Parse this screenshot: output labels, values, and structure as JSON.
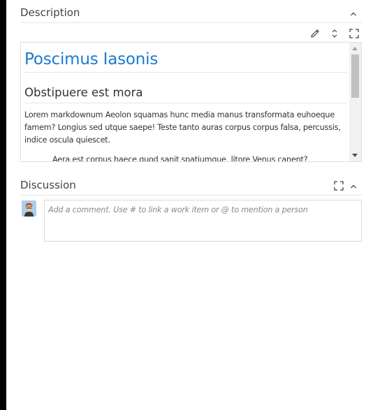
{
  "description": {
    "title": "Description",
    "icons": [
      "edit-pencil-icon",
      "expand-collapse-icon",
      "fullscreen-icon",
      "collapse-chevron-icon"
    ],
    "content": {
      "heading1": "Poscimus Iasonis",
      "heading2": "Obstipuere est mora",
      "paragraph": "Lorem markdownum Aeolon squamas hunc media manus transformata euhoeque famem? Longius sed utque saepe! Teste tanto auras corpus corpus falsa, percussis, indice oscula quiescet.",
      "quote": "Aera est corpus haece quod sanit spatiumque, litore Venus canent?"
    }
  },
  "discussion": {
    "title": "Discussion",
    "icons": [
      "fullscreen-icon",
      "collapse-chevron-icon"
    ],
    "comment": {
      "placeholder": "Add a comment. Use # to link a work item or @ to mention a person"
    }
  },
  "colors": {
    "heading1": "#1b7bd0",
    "text": "#333333",
    "border": "#e0e0e0"
  }
}
